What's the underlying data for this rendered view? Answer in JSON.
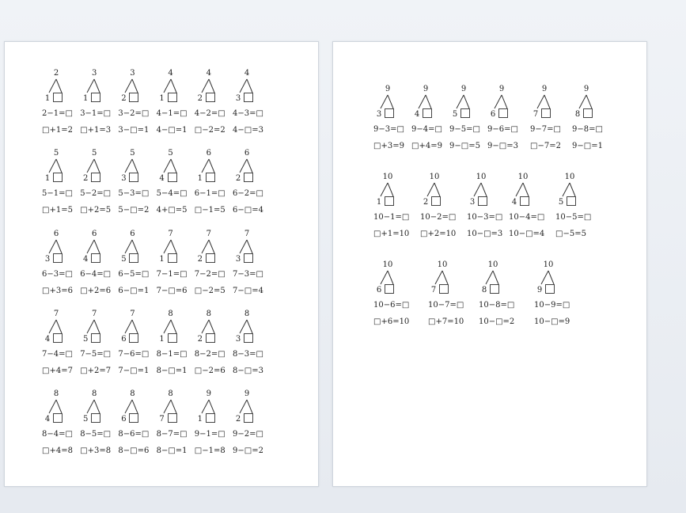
{
  "pages": [
    {
      "rows": [
        [
          {
            "top": "2",
            "part": "1",
            "eq1": "2−1=□",
            "eq2": "□+1=2"
          },
          {
            "top": "3",
            "part": "1",
            "eq1": "3−1=□",
            "eq2": "□+1=3"
          },
          {
            "top": "3",
            "part": "2",
            "eq1": "3−2=□",
            "eq2": "3−□=1"
          },
          {
            "top": "4",
            "part": "1",
            "eq1": "4−1=□",
            "eq2": "4−□=1"
          },
          {
            "top": "4",
            "part": "2",
            "eq1": "4−2=□",
            "eq2": "□−2=2"
          },
          {
            "top": "4",
            "part": "3",
            "eq1": "4−3=□",
            "eq2": "4−□=3"
          }
        ],
        [
          {
            "top": "5",
            "part": "1",
            "eq1": "5−1=□",
            "eq2": "□+1=5"
          },
          {
            "top": "5",
            "part": "2",
            "eq1": "5−2=□",
            "eq2": "□+2=5"
          },
          {
            "top": "5",
            "part": "3",
            "eq1": "5−3=□",
            "eq2": "5−□=2"
          },
          {
            "top": "5",
            "part": "4",
            "eq1": "5−4=□",
            "eq2": "4+□=5"
          },
          {
            "top": "6",
            "part": "1",
            "eq1": "6−1=□",
            "eq2": "□−1=5"
          },
          {
            "top": "6",
            "part": "2",
            "eq1": "6−2=□",
            "eq2": "6−□=4"
          }
        ],
        [
          {
            "top": "6",
            "part": "3",
            "eq1": "6−3=□",
            "eq2": "□+3=6"
          },
          {
            "top": "6",
            "part": "4",
            "eq1": "6−4=□",
            "eq2": "□+2=6"
          },
          {
            "top": "6",
            "part": "5",
            "eq1": "6−5=□",
            "eq2": "6−□=1"
          },
          {
            "top": "7",
            "part": "1",
            "eq1": "7−1=□",
            "eq2": "7−□=6"
          },
          {
            "top": "7",
            "part": "2",
            "eq1": "7−2=□",
            "eq2": "□−2=5"
          },
          {
            "top": "7",
            "part": "3",
            "eq1": "7−3=□",
            "eq2": "7−□=4"
          }
        ],
        [
          {
            "top": "7",
            "part": "4",
            "eq1": "7−4=□",
            "eq2": "□+4=7"
          },
          {
            "top": "7",
            "part": "5",
            "eq1": "7−5=□",
            "eq2": "□+2=7"
          },
          {
            "top": "7",
            "part": "6",
            "eq1": "7−6=□",
            "eq2": "7−□=1"
          },
          {
            "top": "8",
            "part": "1",
            "eq1": "8−1=□",
            "eq2": "8−□=1"
          },
          {
            "top": "8",
            "part": "2",
            "eq1": "8−2=□",
            "eq2": "□−2=6"
          },
          {
            "top": "8",
            "part": "3",
            "eq1": "8−3=□",
            "eq2": "8−□=3"
          }
        ],
        [
          {
            "top": "8",
            "part": "4",
            "eq1": "8−4=□",
            "eq2": "□+4=8"
          },
          {
            "top": "8",
            "part": "5",
            "eq1": "8−5=□",
            "eq2": "□+3=8"
          },
          {
            "top": "8",
            "part": "6",
            "eq1": "8−6=□",
            "eq2": "8−□=6"
          },
          {
            "top": "8",
            "part": "7",
            "eq1": "8−7=□",
            "eq2": "8−□=1"
          },
          {
            "top": "9",
            "part": "1",
            "eq1": "9−1=□",
            "eq2": "□−1=8"
          },
          {
            "top": "9",
            "part": "2",
            "eq1": "9−2=□",
            "eq2": "9−□=2"
          }
        ]
      ]
    },
    {
      "rows": [
        [
          {
            "top": "9",
            "part": "3",
            "eq1": "9−3=□",
            "eq2": "□+3=9"
          },
          {
            "top": "9",
            "part": "4",
            "eq1": "9−4=□",
            "eq2": "□+4=9"
          },
          {
            "top": "9",
            "part": "5",
            "eq1": "9−5=□",
            "eq2": "9−□=5"
          },
          {
            "top": "9",
            "part": "6",
            "eq1": "9−6=□",
            "eq2": "9−□=3"
          },
          {
            "top": "9",
            "part": "7",
            "eq1": "9−7=□",
            "eq2": "□−7=2"
          },
          {
            "top": "9",
            "part": "8",
            "eq1": "9−8=□",
            "eq2": "9−□=1"
          }
        ],
        [
          {
            "top": "10",
            "part": "1",
            "eq1": "10−1=□",
            "eq2": "□+1=10"
          },
          {
            "top": "10",
            "part": "2",
            "eq1": "10−2=□",
            "eq2": "□+2=10"
          },
          {
            "top": "10",
            "part": "3",
            "eq1": "10−3=□",
            "eq2": "10−□=3"
          },
          {
            "top": "10",
            "part": "4",
            "eq1": "10−4=□",
            "eq2": "10−□=4"
          },
          {
            "top": "10",
            "part": "5",
            "eq1": "10−5=□",
            "eq2": "□−5=5"
          }
        ],
        [
          {
            "top": "10",
            "part": "6",
            "eq1": "10−6=□",
            "eq2": "□+6=10"
          },
          {
            "top": "10",
            "part": "7",
            "eq1": "10−7=□",
            "eq2": "□+7=10"
          },
          {
            "top": "10",
            "part": "8",
            "eq1": "10−8=□",
            "eq2": "10−□=2"
          },
          {
            "top": "10",
            "part": "9",
            "eq1": "10−9=□",
            "eq2": "10−□=9"
          }
        ]
      ]
    }
  ]
}
